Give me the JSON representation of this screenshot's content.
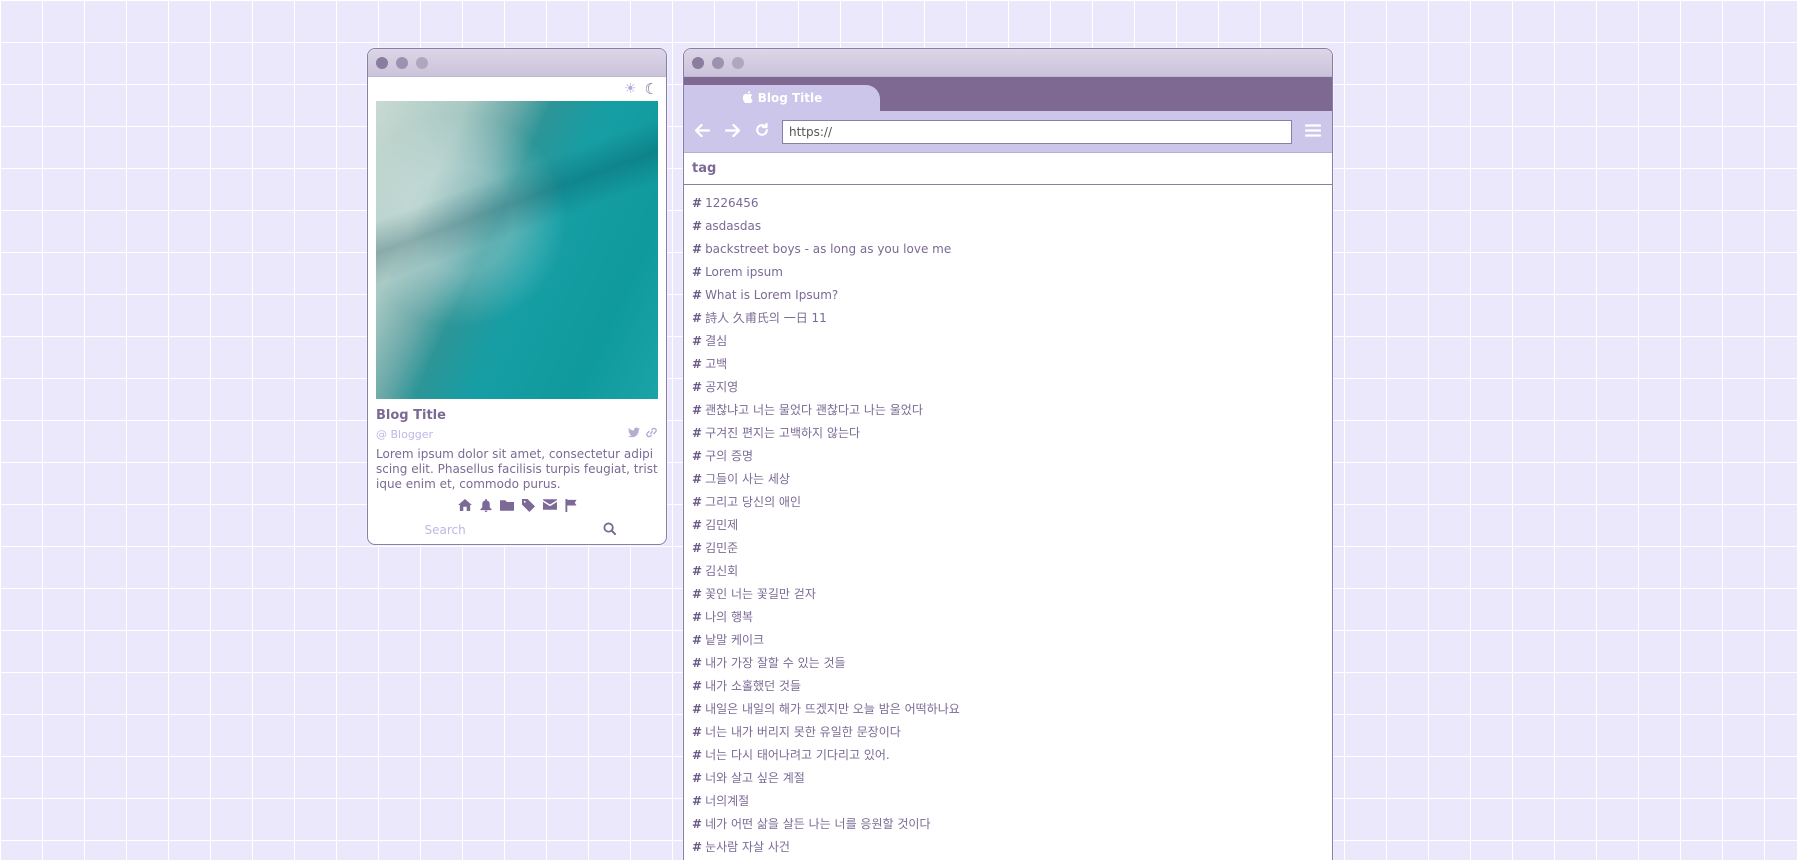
{
  "sidebar_window": {
    "blog_title": "Blog Title",
    "blogger": "@ Blogger",
    "description": "Lorem ipsum dolor sit amet, consectetur adipiscing elit. Phasellus facilisis turpis feugiat, tristique enim et, commodo purus.",
    "search_placeholder": "Search",
    "theme_icons": [
      "sun-icon",
      "moon-icon"
    ],
    "social_icons": [
      "twitter-icon",
      "link-icon"
    ],
    "nav_icons": [
      "home-icon",
      "bell-icon",
      "folder-icon",
      "tag-icon",
      "mail-icon",
      "flag-icon"
    ]
  },
  "browser": {
    "tab_title": "Blog Title",
    "url": "https://",
    "page_heading": "tag",
    "tags": [
      "1226456",
      "asdasdas",
      "backstreet boys - as long as you love me",
      "Lorem ipsum",
      "What is Lorem Ipsum?",
      "詩人 久甫氏의 一日 11",
      "결심",
      "고백",
      "공지영",
      "괜찮냐고 너는 물었다 괜찮다고 나는 울었다",
      "구겨진 편지는 고백하지 않는다",
      "구의 증명",
      "그들이 사는 세상",
      "그리고 당신의 애인",
      "김민제",
      "김민준",
      "김신회",
      "꽃인 너는 꽃길만 걷자",
      "나의 행복",
      "낱말 케이크",
      "내가 가장 잘할 수 있는 것들",
      "내가 소홀했던 것들",
      "내일은 내일의 해가 뜨겠지만 오늘 밤은 어떡하나요",
      "너는 내가 버리지 못한 유일한 문장이다",
      "너는 다시 태어나려고 기다리고 있어.",
      "너와 살고 싶은 계절",
      "너의계절",
      "네가 어떤 삶을 살든 나는 너를 응원할 것이다",
      "눈사람 자살 사건"
    ]
  },
  "colors": {
    "background": "#ebe8fb",
    "accent": "#7d6991",
    "text": "#7b6a95",
    "muted": "#c2b6e4",
    "toolbar": "#cbc6ea"
  }
}
